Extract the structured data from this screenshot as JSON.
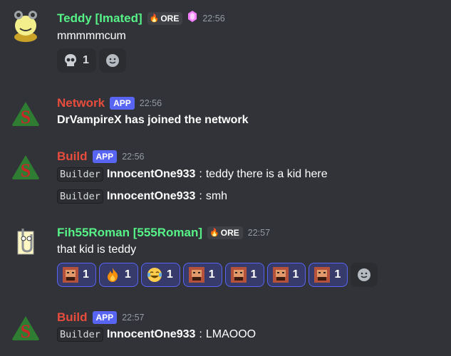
{
  "messages": [
    {
      "username": "Teddy [Imated]",
      "username_color": "#57f287",
      "tag": "ORE",
      "timestamp": "22:56",
      "text": "mmmmmcum",
      "reactions": [
        {
          "emoji": "skull-emoji",
          "glyph": "💀",
          "count": "1"
        }
      ]
    },
    {
      "username": "Network",
      "username_color": "#e74c3c",
      "badge": "APP",
      "timestamp": "22:56",
      "text": "DrVampireX has joined the network"
    },
    {
      "username": "Build",
      "username_color": "#e74c3c",
      "badge": "APP",
      "timestamp": "22:56",
      "lines": [
        {
          "code": "Builder",
          "user": "InnocentOne933",
          "text": "teddy there is a kid here"
        },
        {
          "code": "Builder",
          "user": "InnocentOne933",
          "text": "smh"
        }
      ]
    },
    {
      "username": "Fih55Roman [555Roman]",
      "username_color": "#57f287",
      "tag": "ORE",
      "timestamp": "22:57",
      "text": "that kid is teddy",
      "reactions": [
        {
          "emoji": "face-emoji",
          "count": "1"
        },
        {
          "emoji": "fire-emoji",
          "glyph": "🔥",
          "count": "1"
        },
        {
          "emoji": "joy-emoji",
          "glyph": "😂",
          "count": "1"
        },
        {
          "emoji": "face-emoji",
          "count": "1"
        },
        {
          "emoji": "face-emoji",
          "count": "1"
        },
        {
          "emoji": "face-emoji",
          "count": "1"
        },
        {
          "emoji": "face-emoji",
          "count": "1"
        }
      ]
    },
    {
      "username": "Build",
      "username_color": "#e74c3c",
      "badge": "APP",
      "timestamp": "22:57",
      "lines": [
        {
          "code": "Builder",
          "user": "InnocentOne933",
          "text": "LMAOOO"
        }
      ]
    }
  ],
  "colors": {
    "background": "#313338",
    "app_badge": "#5865f2",
    "reaction_mine_border": "#5865f2"
  }
}
